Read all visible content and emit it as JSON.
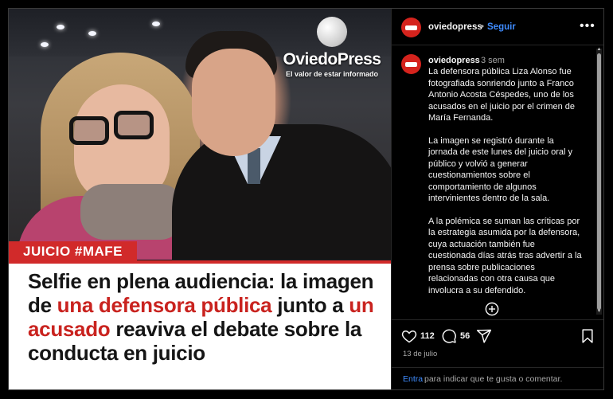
{
  "image": {
    "logo_name": "OviedoPress",
    "logo_tagline": "El valor de estar informado",
    "tag": "JUICIO #MAFE",
    "headline_parts": [
      {
        "text": "Selfie en plena audiencia: la imagen de ",
        "accent": false
      },
      {
        "text": "una defensora pública",
        "accent": true
      },
      {
        "text": " junto a ",
        "accent": false
      },
      {
        "text": "un acusado",
        "accent": true
      },
      {
        "text": " reaviva el debate sobre la conducta en juicio",
        "accent": false
      }
    ],
    "accent_color": "#c9231f"
  },
  "header": {
    "username": "oviedopress",
    "separator": "•",
    "follow_label": "Seguir",
    "more_icon": "more-horizontal-icon"
  },
  "comment": {
    "username": "oviedopress",
    "time": "3 sem",
    "paragraphs": [
      "La defensora pública Liza Alonso fue fotografiada sonriendo junto a Franco Antonio Acosta Céspedes, uno de los acusados en el juicio por el crimen de María Fernanda.",
      "La imagen se registró durante la jornada de este lunes del juicio oral y público y volvió a generar cuestionamientos sobre el comportamiento de algunos intervinientes dentro de la sala.",
      "A la polémica se suman las críticas por la estrategia asumida por la defensora, cuya actuación también fue cuestionada días atrás tras advertir a la prensa sobre publicaciones relacionadas con otra causa que involucra a su defendido."
    ],
    "add_icon": "plus-circle-icon"
  },
  "actions": {
    "likes": "112",
    "comments": "56",
    "date": "13 de julio"
  },
  "footer": {
    "login_link": "Entra",
    "login_text": "para indicar que te gusta o comentar."
  },
  "colors": {
    "brand_red": "#d12a2a",
    "link_blue": "#3f8cff"
  }
}
